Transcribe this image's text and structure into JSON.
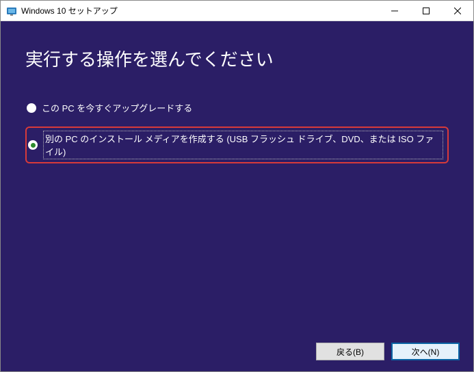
{
  "window": {
    "title": "Windows 10 セットアップ"
  },
  "content": {
    "heading": "実行する操作を選んでください",
    "options": {
      "upgrade": "この PC を今すぐアップグレードする",
      "media": "別の PC のインストール メディアを作成する (USB フラッシュ ドライブ、DVD、または ISO ファイル)"
    }
  },
  "buttons": {
    "back": "戻る(B)",
    "next": "次へ(N)"
  },
  "selected_option": "media"
}
